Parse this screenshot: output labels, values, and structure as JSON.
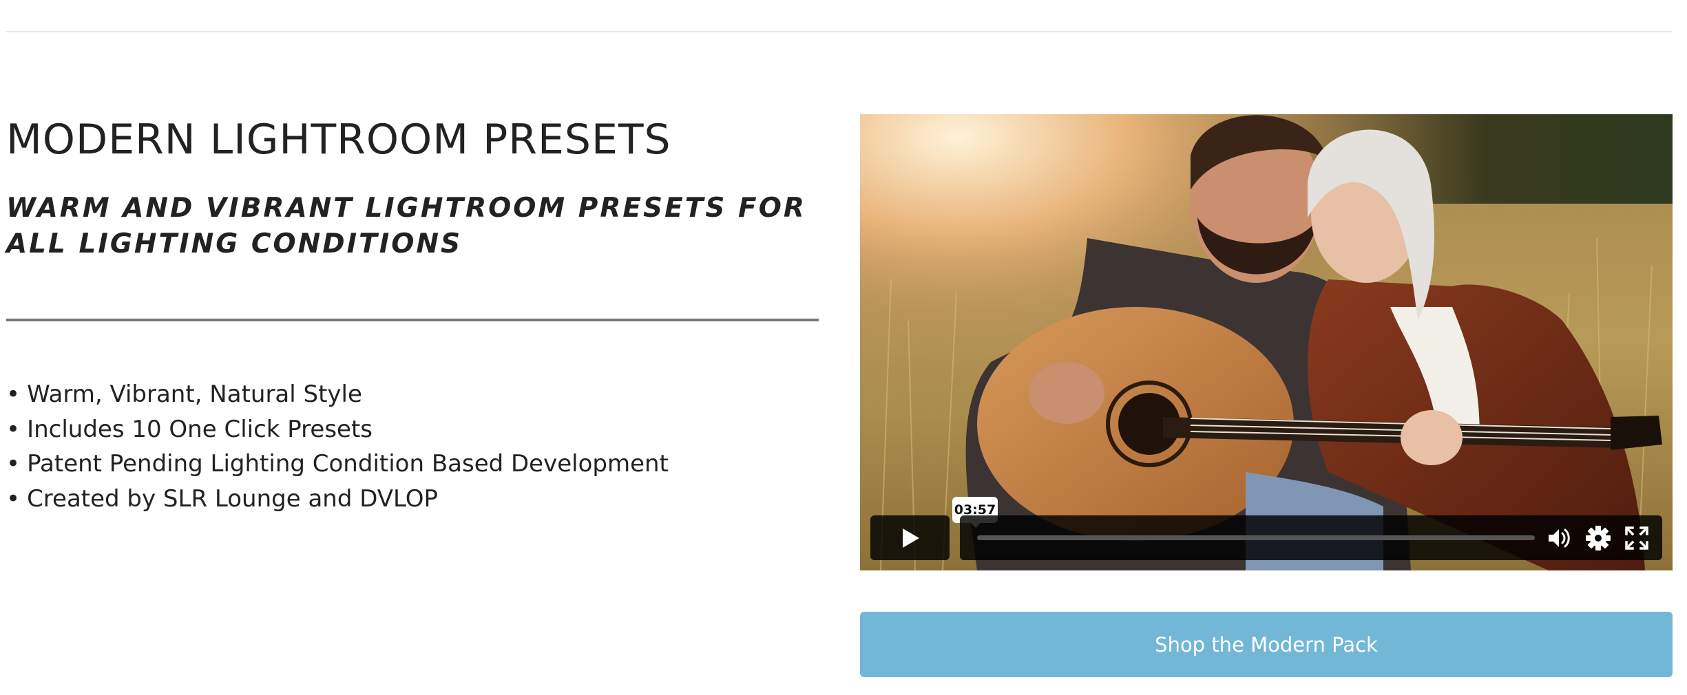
{
  "header": {
    "title": "MODERN LIGHTROOM PRESETS",
    "subtitle": "WARM AND VIBRANT LIGHTROOM PRESETS FOR ALL LIGHTING CONDITIONS"
  },
  "features": [
    {
      "bullet": "•",
      "text": "Warm, Vibrant, Natural Style"
    },
    {
      "bullet": "•",
      "text": "Includes 10 One Click Presets"
    },
    {
      "bullet": "•",
      "text": "Patent Pending Lighting Condition Based Development"
    },
    {
      "bullet": "•",
      "text": "Created by SLR Lounge and DVLOP"
    }
  ],
  "video": {
    "duration": "03:57",
    "progress_fraction": 0.0,
    "icons": {
      "play": "play-icon",
      "volume": "volume-icon",
      "settings": "gear-icon",
      "fullscreen": "fullscreen-icon"
    }
  },
  "cta": {
    "label": "Shop the Modern Pack"
  },
  "colors": {
    "accent": "#73b7d6",
    "text": "#222222",
    "divider": "#777777"
  }
}
